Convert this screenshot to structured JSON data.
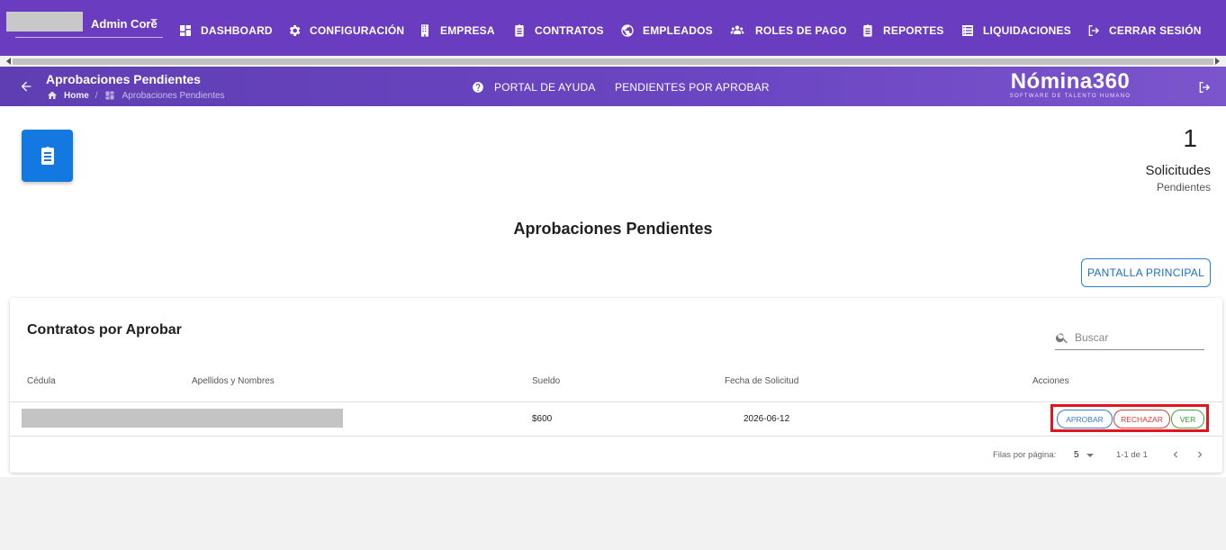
{
  "topbar": {
    "user": {
      "name": "Admin Core"
    },
    "nav": [
      {
        "label": "DASHBOARD",
        "icon": "dashboard-icon"
      },
      {
        "label": "CONFIGURACIÓN",
        "icon": "gear-icon"
      },
      {
        "label": "EMPRESA",
        "icon": "building-icon"
      },
      {
        "label": "CONTRATOS",
        "icon": "clipboard-icon"
      },
      {
        "label": "EMPLEADOS",
        "icon": "globe-icon"
      },
      {
        "label": "ROLES DE PAGO",
        "icon": "group-icon"
      },
      {
        "label": "REPORTES",
        "icon": "report-icon"
      },
      {
        "label": "LIQUIDACIONES",
        "icon": "list-icon"
      },
      {
        "label": "CERRAR SESIÓN",
        "icon": "logout-icon"
      }
    ]
  },
  "subbar": {
    "page_title": "Aprobaciones Pendientes",
    "breadcrumb": {
      "home": "Home",
      "separator": "/",
      "current": "Aprobaciones Pendientes"
    },
    "links": [
      {
        "label": "PORTAL DE AYUDA",
        "icon": "help-icon"
      },
      {
        "label": "PENDIENTES POR APROBAR"
      }
    ],
    "logo": {
      "brand": "Nómina360",
      "tagline": "SOFTWARE DE TALENTO HUMANO"
    }
  },
  "stats": {
    "count": "1",
    "label": "Solicitudes",
    "sub": "Pendientes"
  },
  "main": {
    "title": "Aprobaciones Pendientes",
    "main_button": "PANTALLA PRINCIPAL"
  },
  "table": {
    "title": "Contratos por Aprobar",
    "search_placeholder": "Buscar",
    "columns": [
      "Cédula",
      "Apellidos y Nombres",
      "Sueldo",
      "Fecha de Solicitud",
      "Acciones"
    ],
    "rows": [
      {
        "sueldo": "$600",
        "fecha": "2026-06-12",
        "actions": [
          "APROBAR",
          "RECHAZAR",
          "VER"
        ]
      }
    ],
    "pagination": {
      "rows_label": "Filas por página:",
      "rows_value": "5",
      "range": "1-1 de 1"
    }
  },
  "colors": {
    "primary_purple": "#6a3cc0",
    "accent_blue": "#1379e0",
    "highlight_red": "#e3141e"
  }
}
